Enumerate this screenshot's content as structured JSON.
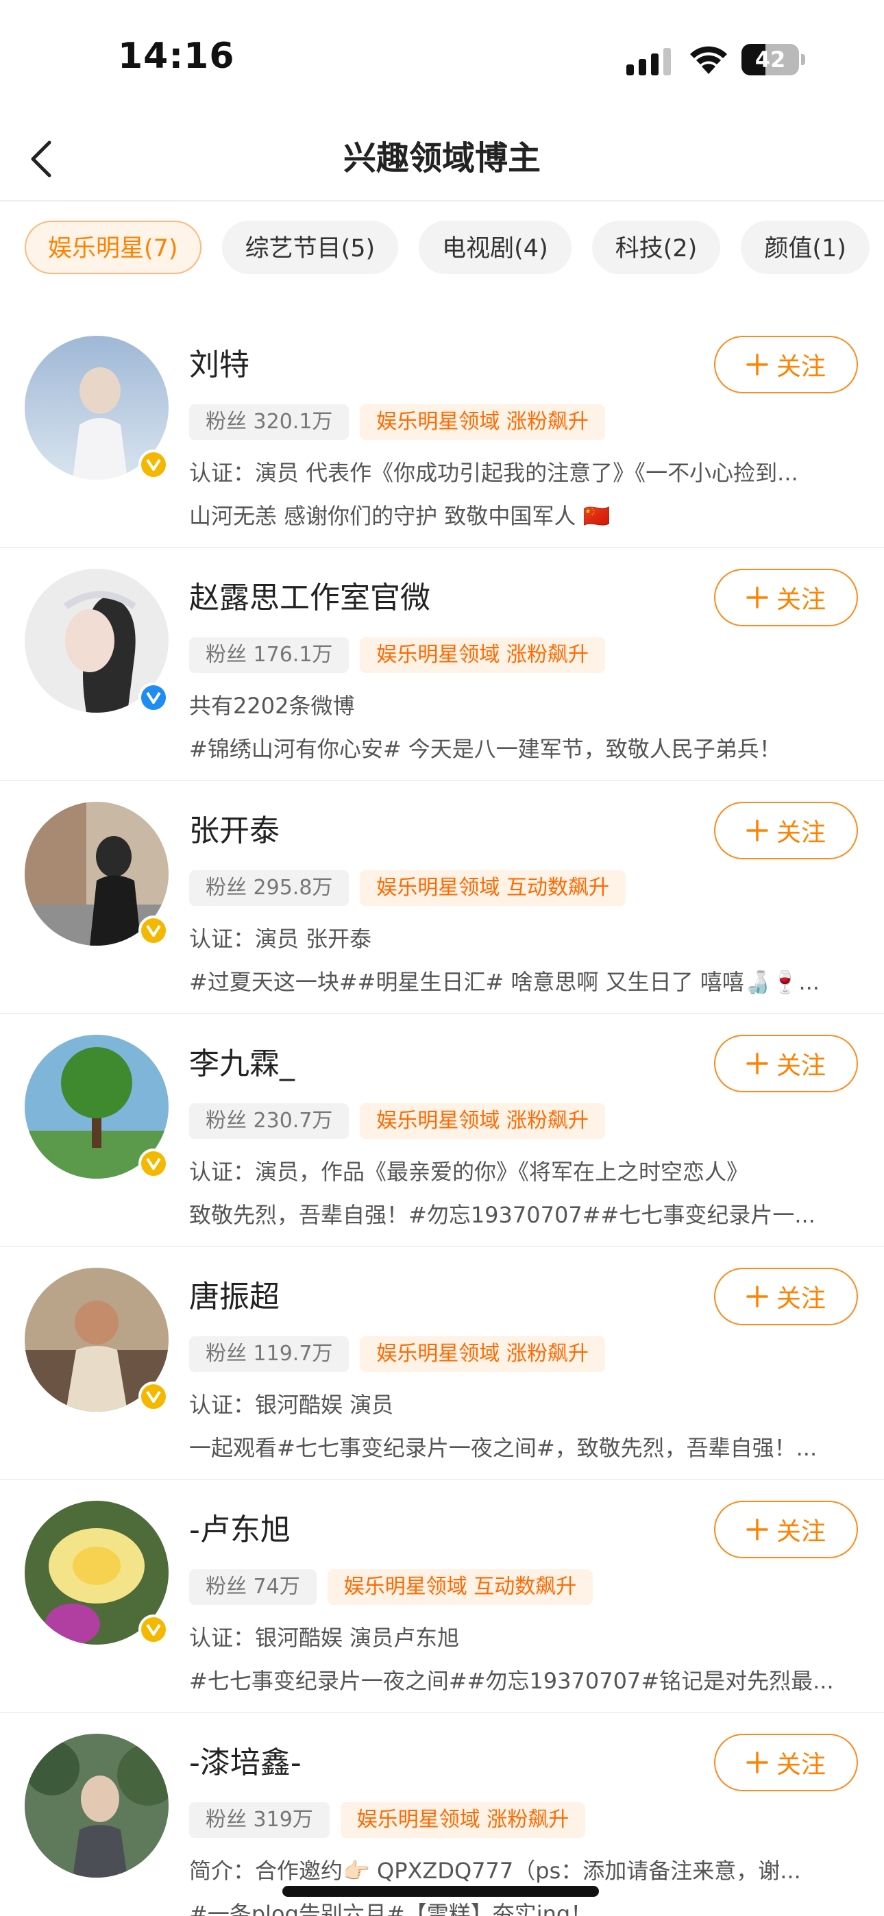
{
  "status": {
    "time": "14:16",
    "battery": "42",
    "battery_level": 0.42
  },
  "nav": {
    "title": "兴趣领域博主"
  },
  "tabs": [
    {
      "label": "娱乐明星(7)",
      "active": true
    },
    {
      "label": "综艺节目(5)",
      "active": false
    },
    {
      "label": "电视剧(4)",
      "active": false
    },
    {
      "label": "科技(2)",
      "active": false
    },
    {
      "label": "颜值(1)",
      "active": false
    }
  ],
  "follow_label": "关注",
  "items": [
    {
      "name": "刘特",
      "fans": "粉丝 320.1万",
      "tag": "娱乐明星领域 涨粉飙升",
      "desc1": "认证：演员 代表作《你成功引起我的注意了》《一不小心捡到...",
      "desc2": "山河无恙 感谢你们的守护 致敬中国军人 🇨🇳",
      "badge": "gold"
    },
    {
      "name": "赵露思工作室官微",
      "fans": "粉丝 176.1万",
      "tag": "娱乐明星领域 涨粉飙升",
      "desc1": "共有2202条微博",
      "desc2": "#锦绣山河有你心安# 今天是八一建军节，致敬人民子弟兵！",
      "badge": "blue"
    },
    {
      "name": "张开泰",
      "fans": "粉丝 295.8万",
      "tag": "娱乐明星领域 互动数飙升",
      "desc1": "认证：演员 张开泰",
      "desc2": "#过夏天这一块##明星生日汇# 啥意思啊 又生日了 嘻嘻🍶🍷...",
      "badge": "gold"
    },
    {
      "name": "李九霖_",
      "fans": "粉丝 230.7万",
      "tag": "娱乐明星领域 涨粉飙升",
      "desc1": "认证：演员，作品《最亲爱的你》《将军在上之时空恋人》",
      "desc2": "致敬先烈，吾辈自强！#勿忘19370707##七七事变纪录片一...",
      "badge": "gold"
    },
    {
      "name": "唐振超",
      "fans": "粉丝 119.7万",
      "tag": "娱乐明星领域 涨粉飙升",
      "desc1": "认证：银河酷娱 演员",
      "desc2": "一起观看#七七事变纪录片一夜之间#，致敬先烈，吾辈自强！...",
      "badge": "gold"
    },
    {
      "name": "-卢东旭",
      "fans": "粉丝 74万",
      "tag": "娱乐明星领域 互动数飙升",
      "desc1": "认证：银河酷娱 演员卢东旭",
      "desc2": "#七七事变纪录片一夜之间##勿忘19370707#铭记是对先烈最...",
      "badge": "gold"
    },
    {
      "name": "-漆培鑫-",
      "fans": "粉丝 319万",
      "tag": "娱乐明星领域 涨粉飙升",
      "desc1": "简介：合作邀约👉🏻 QPXZDQ777（ps：添加请备注来意，谢...",
      "desc2": "#一条plog告别六月#【雪糕】夯实ing！",
      "badge": "none"
    }
  ]
}
